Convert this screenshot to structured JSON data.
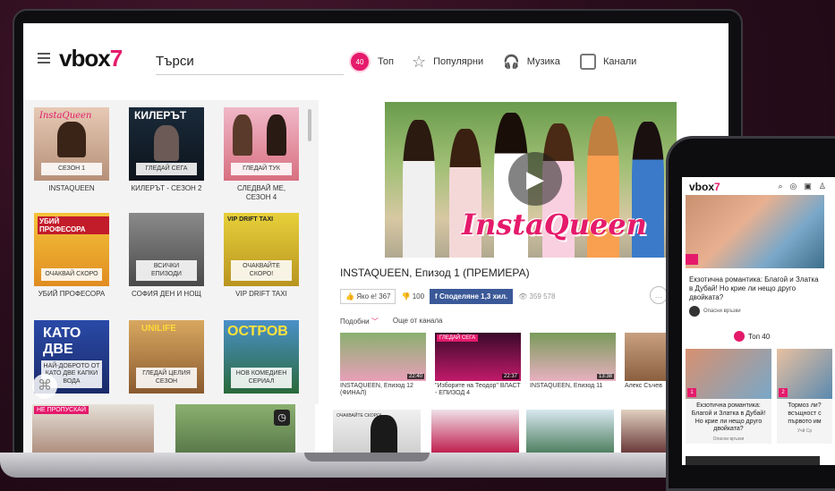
{
  "colors": {
    "accent": "#e51a6b",
    "facebook": "#3b5998"
  },
  "header": {
    "logo_main": "vbox",
    "logo_accent": "7",
    "search_value": "Търси",
    "nav": [
      {
        "label": "Топ",
        "badge": "40",
        "icon": "top40-badge-icon"
      },
      {
        "label": "Популярни",
        "icon": "star-icon"
      },
      {
        "label": "Музика",
        "icon": "headphones-icon"
      },
      {
        "label": "Канали",
        "icon": "channels-icon"
      }
    ]
  },
  "grid": [
    {
      "label": "СЕЗОН 1",
      "caption": "INSTAQUEEN",
      "thumb_title": "InstaQueen"
    },
    {
      "label": "ГЛЕДАЙ СЕГА",
      "caption": "КИЛЕРЪТ - СЕЗОН 2",
      "thumb_title": "КИЛЕРЪТ"
    },
    {
      "label": "ГЛЕДАЙ ТУК",
      "caption": "СЛЕДВАЙ МЕ, СЕЗОН 4",
      "thumb_title": ""
    },
    {
      "label": "ОЧАКВАЙ СКОРО",
      "caption": "УБИЙ ПРОФЕСОРА",
      "thumb_title": "УБИЙ ПРОФЕСОРА"
    },
    {
      "label": "ВСИЧКИ ЕПИЗОДИ",
      "caption": "СОФИЯ ДЕН И НОЩ",
      "thumb_title": ""
    },
    {
      "label": "ОЧАКВАЙТЕ СКОРО!",
      "caption": "VIP DRIFT TAXI",
      "thumb_title": "VIP DRIFT TAXI"
    },
    {
      "label": "НАЙ-ДОБРОТО ОТ КАТО ДВЕ КАПКИ ВОДА",
      "caption": "",
      "thumb_title": "КАТО ДВЕ"
    },
    {
      "label": "ГЛЕДАЙ ЦЕЛИЯ СЕЗОН",
      "caption": "",
      "thumb_title": "UNILIFE"
    },
    {
      "label": "НОВ КОМЕДИЕН СЕРИАЛ",
      "caption": "",
      "thumb_title": "ОСТРОВ"
    }
  ],
  "bottom_left": {
    "tag": "НЕ ПРОПУСКАЙ"
  },
  "player": {
    "title": "INSTAQUEEN, Епизод 1 (ПРЕМИЕРА)",
    "show_logo": "InstaQueen",
    "like_label": "Яко е! 367",
    "dislike_count": "100",
    "share_label": "Споделяне 1,3 хил.",
    "views": "359 578"
  },
  "tabs": [
    {
      "label": "Подобни"
    },
    {
      "label": "Още от канала"
    }
  ],
  "related": [
    {
      "caption": "INSTAQUEEN, Епизод 12 (ФИНАЛ)",
      "duration": "22:40",
      "tag": ""
    },
    {
      "caption": "\"Изборите на Теодор\" ВЛАСТ - ЕПИЗОД 4",
      "duration": "22:37",
      "tag": "ГЛЕДАЙ СЕГА"
    },
    {
      "caption": "INSTAQUEEN, Епизод 11",
      "duration": "13:38",
      "tag": ""
    },
    {
      "caption": "Алекс Съчев",
      "duration": "",
      "tag": ""
    }
  ],
  "bottom_strip": {
    "card1_label": "ОЧАКВАЙТЕ СКОРО!"
  },
  "phone": {
    "logo_main": "vbox",
    "logo_accent": "7",
    "headline": "Екзотична романтика: Благой и Златка в Дубай! Но крие ли нещо друго двойката?",
    "source": "Опасни връзки",
    "top_label": "Топ 40",
    "cards": [
      {
        "num": "1",
        "caption": "Екзотична романтика: Благой и Златка в Дубай! Но крие ли нещо друго двойката?",
        "source": "Опасни връзки"
      },
      {
        "num": "2",
        "caption": "Тормоз ли? всъщност с първото им",
        "source": "Учй Ср"
      }
    ]
  }
}
